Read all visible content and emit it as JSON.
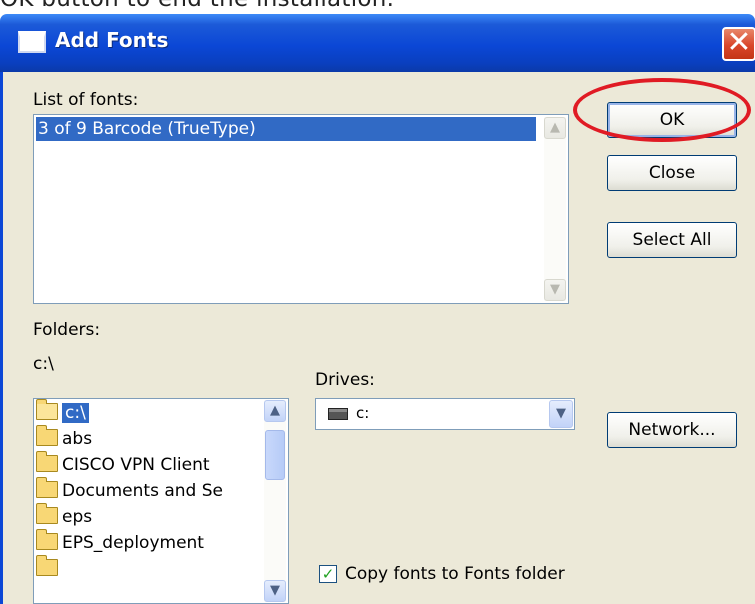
{
  "caption": "OK  button to end the installation.",
  "window": {
    "title": "Add Fonts",
    "close_glyph": "✕"
  },
  "fonts": {
    "label": "List of fonts:",
    "items": [
      "3 of 9 Barcode (TrueType)"
    ]
  },
  "buttons": {
    "ok": "OK",
    "close": "Close",
    "select_all": "Select All",
    "network": "Network..."
  },
  "folders": {
    "label": "Folders:",
    "current_path": "c:\\",
    "items": [
      "c:\\",
      "abs",
      "CISCO VPN Client",
      "Documents and Se",
      "eps",
      "EPS_deployment"
    ]
  },
  "drives": {
    "label": "Drives:",
    "selected": "c:"
  },
  "copy_fonts": {
    "label": "Copy fonts to Fonts folder",
    "checked": true
  },
  "colors": {
    "titlebar": "#0b47d6",
    "dialog_bg": "#ece9d8",
    "selection": "#316ac5",
    "highlight_ring": "#e01b24"
  },
  "icons": {
    "title": "window-icon",
    "open_folder": "open-folder-icon",
    "folder": "folder-icon",
    "drive": "hard-drive-icon",
    "check": "checkmark-icon"
  }
}
